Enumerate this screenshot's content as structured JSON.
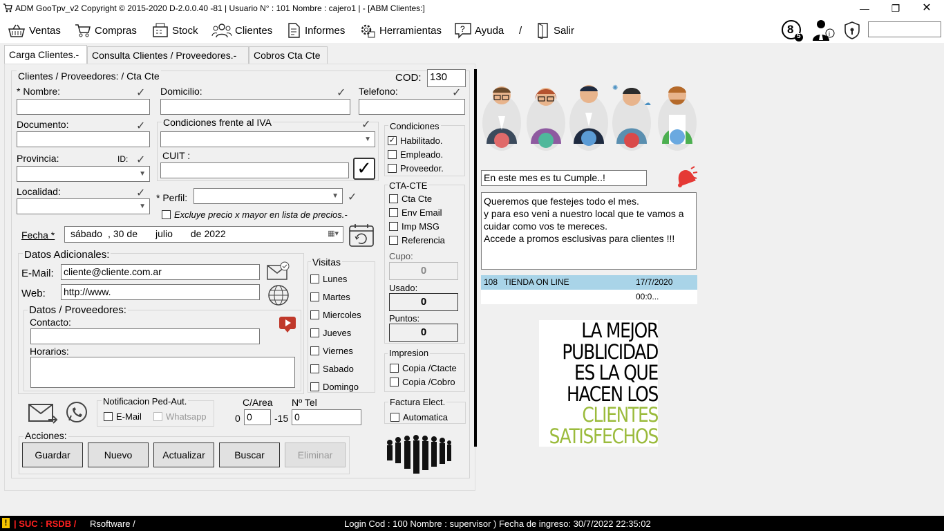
{
  "window": {
    "title": "ADM GooTpv_v2 Copyright ©  2015-2020 D-2.0.0.40 -81 | Usuario N° : 101 Nombre : cajero1 | - [ABM Clientes:]"
  },
  "menu": {
    "items": [
      {
        "label": "Ventas",
        "icon": "basket-icon"
      },
      {
        "label": "Compras",
        "icon": "cart-icon"
      },
      {
        "label": "Stock",
        "icon": "register-icon"
      },
      {
        "label": "Clientes",
        "icon": "users-icon"
      },
      {
        "label": "Informes",
        "icon": "report-icon"
      },
      {
        "label": "Herramientas",
        "icon": "tools-icon"
      },
      {
        "label": "Ayuda",
        "icon": "help-icon"
      },
      {
        "label": "/",
        "icon": ""
      },
      {
        "label": "Salir",
        "icon": "exit-door-icon"
      }
    ],
    "badge_count": "5",
    "badge_main": "8"
  },
  "tabs": [
    "Carga Clientes.-",
    "Consulta Clientes / Proveedores.-",
    "Cobros Cta Cte"
  ],
  "form": {
    "group_title": "Clientes / Proveedores: / Cta Cte",
    "cod_label": "COD:",
    "cod_value": "130",
    "nombre_label": "* Nombre:",
    "domicilio_label": "Domicilio:",
    "telefono_label": "Telefono:",
    "documento_label": "Documento:",
    "iva_label": "Condiciones frente al IVA",
    "provincia_label": "Provincia:",
    "id_label": "ID:",
    "cuit_label": "CUIT :",
    "localidad_label": "Localidad:",
    "perfil_label": "* Perfil:",
    "excluye_label": "Excluye precio x mayor en lista de precios.-",
    "fecha_label": "Fecha *",
    "fecha": {
      "dia": "sábado",
      "sep": ",",
      "num": "30",
      "de1": "de",
      "mes": "julio",
      "de2": "de",
      "anio": "2022"
    }
  },
  "datos": {
    "title": "Datos Adicionales:",
    "email_label": "E-Mail:",
    "email_value": "cliente@cliente.com.ar",
    "web_label": "Web:",
    "web_value": "http://www.",
    "prov_title": "Datos / Proveedores:",
    "contacto_label": "Contacto:",
    "horarios_label": "Horarios:"
  },
  "visitas": {
    "title": "Visitas",
    "days": [
      "Lunes",
      "Martes",
      "Miercoles",
      "Jueves",
      "Viernes",
      "Sabado",
      "Domingo"
    ]
  },
  "condiciones": {
    "title": "Condiciones",
    "items": [
      {
        "label": "Habilitado.",
        "checked": true
      },
      {
        "label": "Empleado.",
        "checked": false
      },
      {
        "label": "Proveedor.",
        "checked": false
      }
    ]
  },
  "ctacte": {
    "title": "CTA-CTE",
    "items": [
      "Cta Cte",
      "Env Email",
      "Imp MSG",
      "Referencia"
    ],
    "cupo_label": "Cupo:",
    "cupo_value": "0",
    "usado_label": "Usado:",
    "usado_value": "0",
    "puntos_label": "Puntos:",
    "puntos_value": "0"
  },
  "impresion": {
    "title": "Impresion",
    "items": [
      "Copia /Ctacte",
      "Copia /Cobro"
    ]
  },
  "factura": {
    "title": "Factura Elect.",
    "item": "Automatica"
  },
  "notificacion": {
    "title": "Notificacion Ped-Aut.",
    "email": "E-Mail",
    "whatsapp": "Whatsapp"
  },
  "tel": {
    "area_label": "C/Area",
    "num_label": "Nº Tel",
    "prefix0": "0",
    "area_value": "0",
    "prefix15": "-15",
    "num_value": "0"
  },
  "acciones": {
    "title": "Acciones:",
    "buttons": [
      "Guardar",
      "Nuevo",
      "Actualizar",
      "Buscar",
      "Eliminar"
    ]
  },
  "side": {
    "cumple_value": "En este mes es tu Cumple..!",
    "message": [
      "Queremos que festejes todo el mes.",
      "y para eso veni a nuestro local que te vamos a",
      "cuidar como vos te mereces.",
      "Accede a promos esclusivas para clientes !!!"
    ],
    "row": {
      "id": "108",
      "name": "TIENDA ON LINE",
      "date": "17/7/2020 00:0..."
    },
    "ad_black": [
      "LA MEJOR",
      "PUBLICIDAD",
      "ES LA QUE",
      "HACEN LOS"
    ],
    "ad_green": [
      "CLIENTES",
      "SATISFECHOS"
    ]
  },
  "status": {
    "suc": "| SUC : RSDB /",
    "rsoftware": "Rsoftware /",
    "login": "Login Cod : 100 Nombre : supervisor ) Fecha de ingreso: 30/7/2022 22:35:02"
  },
  "colors": {
    "highlight_row": "#a9d4e8",
    "ad_green": "#9bbb3c",
    "status_red": "#ff2020"
  }
}
